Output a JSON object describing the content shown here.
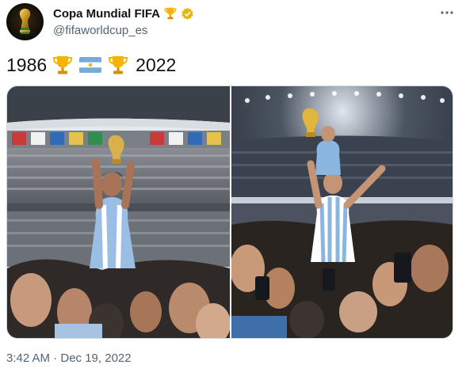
{
  "account": {
    "name": "Copa Mundial FIFA",
    "handle": "@fifaworldcup_es",
    "verified": true,
    "name_emoji": "trophy-emoji",
    "avatar_icon": "world-cup-trophy-icon"
  },
  "menu": {
    "icon": "more-options-icon"
  },
  "tweet": {
    "year_start": "1986",
    "year_end": "2022",
    "emojis": [
      "trophy-emoji",
      "argentina-flag-emoji",
      "trophy-emoji"
    ]
  },
  "media": {
    "photos": [
      {
        "description_icon": "photo-1986-celebration"
      },
      {
        "description_icon": "photo-2022-celebration"
      }
    ]
  },
  "meta": {
    "timestamp": "3:42 AM · Dec 19, 2022"
  },
  "colors": {
    "text_primary": "#0f1419",
    "text_secondary": "#536471",
    "verified_gold": "#e2b719",
    "border": "#cfd9de"
  }
}
